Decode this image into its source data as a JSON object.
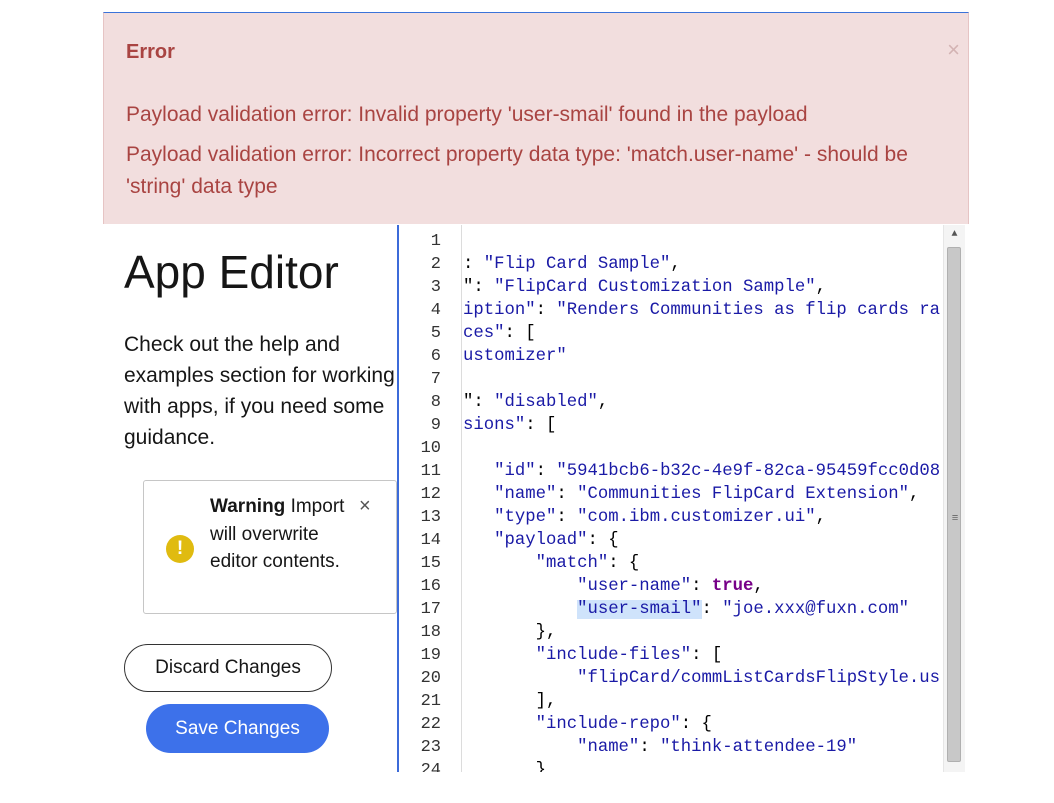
{
  "error": {
    "title": "Error",
    "close": "×",
    "messages": [
      "Payload validation error: Invalid property 'user-smail' found in the payload",
      "Payload validation error: Incorrect property data type: 'match.user-name' - should be 'string' data type"
    ]
  },
  "left": {
    "title": "App Editor",
    "help_text": "Check out the help and examples section for working with apps, if you need some guidance.",
    "warning": {
      "icon": "!",
      "label": "Warning",
      "text": " Import will overwrite editor contents.",
      "close": "×"
    },
    "discard_label": "Discard Changes",
    "save_label": "Save Changes"
  },
  "editor": {
    "line_numbers": [
      "1",
      "2",
      "3",
      "4",
      "5",
      "6",
      "7",
      "8",
      "9",
      "10",
      "11",
      "12",
      "13",
      "14",
      "15",
      "16",
      "17",
      "18",
      "19",
      "20",
      "21",
      "22",
      "23",
      "24"
    ],
    "lines": [
      [],
      [
        {
          "t": ": ",
          "c": "punc"
        },
        {
          "t": "\"Flip Card Sample\"",
          "c": "str"
        },
        {
          "t": ",",
          "c": "punc"
        }
      ],
      [
        {
          "t": "\": ",
          "c": "punc"
        },
        {
          "t": "\"FlipCard Customization Sample\"",
          "c": "str"
        },
        {
          "t": ",",
          "c": "punc"
        }
      ],
      [
        {
          "t": "iption\"",
          "c": "key"
        },
        {
          "t": ": ",
          "c": "punc"
        },
        {
          "t": "\"Renders Communities as flip cards ra",
          "c": "str"
        }
      ],
      [
        {
          "t": "ces\"",
          "c": "key"
        },
        {
          "t": ": [",
          "c": "punc"
        }
      ],
      [
        {
          "t": "ustomizer\"",
          "c": "str"
        }
      ],
      [],
      [
        {
          "t": "\": ",
          "c": "punc"
        },
        {
          "t": "\"disabled\"",
          "c": "str"
        },
        {
          "t": ",",
          "c": "punc"
        }
      ],
      [
        {
          "t": "sions\"",
          "c": "key"
        },
        {
          "t": ": [",
          "c": "punc"
        }
      ],
      [],
      [
        {
          "t": "   ",
          "c": "punc"
        },
        {
          "t": "\"id\"",
          "c": "key"
        },
        {
          "t": ": ",
          "c": "punc"
        },
        {
          "t": "\"5941bcb6-b32c-4e9f-82ca-95459fcc0d08\"",
          "c": "str"
        }
      ],
      [
        {
          "t": "   ",
          "c": "punc"
        },
        {
          "t": "\"name\"",
          "c": "key"
        },
        {
          "t": ": ",
          "c": "punc"
        },
        {
          "t": "\"Communities FlipCard Extension\"",
          "c": "str"
        },
        {
          "t": ",",
          "c": "punc"
        }
      ],
      [
        {
          "t": "   ",
          "c": "punc"
        },
        {
          "t": "\"type\"",
          "c": "key"
        },
        {
          "t": ": ",
          "c": "punc"
        },
        {
          "t": "\"com.ibm.customizer.ui\"",
          "c": "str"
        },
        {
          "t": ",",
          "c": "punc"
        }
      ],
      [
        {
          "t": "   ",
          "c": "punc"
        },
        {
          "t": "\"payload\"",
          "c": "key"
        },
        {
          "t": ": {",
          "c": "punc"
        }
      ],
      [
        {
          "t": "       ",
          "c": "punc"
        },
        {
          "t": "\"match\"",
          "c": "key"
        },
        {
          "t": ": {",
          "c": "punc"
        }
      ],
      [
        {
          "t": "           ",
          "c": "punc"
        },
        {
          "t": "\"user-name\"",
          "c": "key"
        },
        {
          "t": ": ",
          "c": "punc"
        },
        {
          "t": "true",
          "c": "kw"
        },
        {
          "t": ",",
          "c": "punc"
        }
      ],
      [
        {
          "t": "           ",
          "c": "punc"
        },
        {
          "t": "\"user-smail\"",
          "c": "hl"
        },
        {
          "t": ": ",
          "c": "punc"
        },
        {
          "t": "\"joe.xxx@fuxn.com\"",
          "c": "str"
        }
      ],
      [
        {
          "t": "       ",
          "c": "punc"
        },
        {
          "t": "},",
          "c": "punc"
        }
      ],
      [
        {
          "t": "       ",
          "c": "punc"
        },
        {
          "t": "\"include-files\"",
          "c": "key"
        },
        {
          "t": ": [",
          "c": "punc"
        }
      ],
      [
        {
          "t": "           ",
          "c": "punc"
        },
        {
          "t": "\"flipCard/commListCardsFlipStyle.use",
          "c": "str"
        }
      ],
      [
        {
          "t": "       ",
          "c": "punc"
        },
        {
          "t": "],",
          "c": "punc"
        }
      ],
      [
        {
          "t": "       ",
          "c": "punc"
        },
        {
          "t": "\"include-repo\"",
          "c": "key"
        },
        {
          "t": ": {",
          "c": "punc"
        }
      ],
      [
        {
          "t": "           ",
          "c": "punc"
        },
        {
          "t": "\"name\"",
          "c": "key"
        },
        {
          "t": ": ",
          "c": "punc"
        },
        {
          "t": "\"think-attendee-19\"",
          "c": "str"
        }
      ],
      [
        {
          "t": "       ",
          "c": "punc"
        },
        {
          "t": "}",
          "c": "punc"
        }
      ]
    ],
    "scroll_up_icon": "▲",
    "scroll_grip_icon": "≡"
  }
}
